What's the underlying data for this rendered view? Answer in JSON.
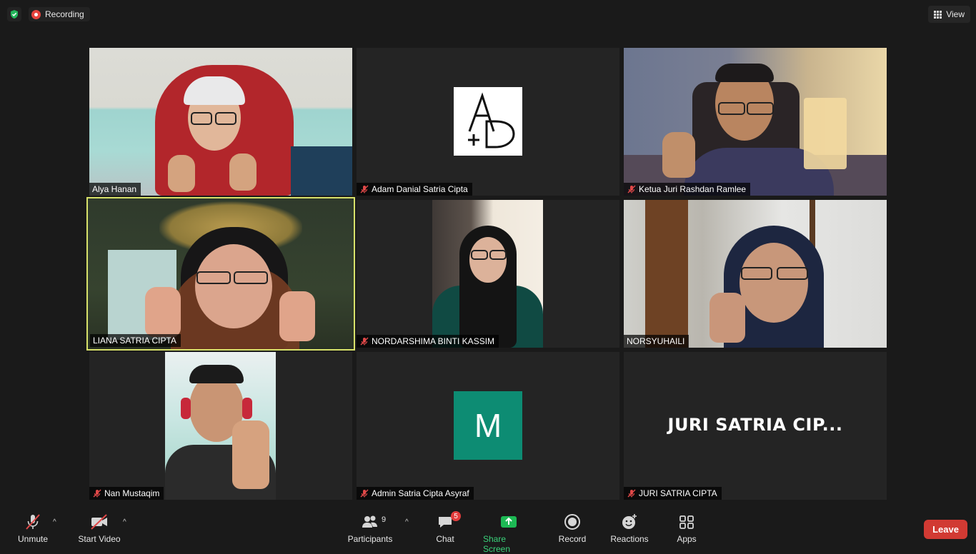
{
  "topbar": {
    "recording_label": "Recording",
    "view_label": "View"
  },
  "participants": [
    {
      "name": "Alya Hanan",
      "muted": false
    },
    {
      "name": "Adam Danial Satria Cipta",
      "muted": true
    },
    {
      "name": "Ketua Juri Rashdan Ramlee",
      "muted": true
    },
    {
      "name": "LIANA SATRIA CIPTA",
      "muted": false,
      "active_speaker": true
    },
    {
      "name": "NORDARSHIMA BINTI KASSIM",
      "muted": true
    },
    {
      "name": "NORSYUHAILI",
      "muted": false
    },
    {
      "name": "Nan Mustaqim",
      "muted": true
    },
    {
      "name": "Admin Satria Cipta Asyraf",
      "muted": true
    },
    {
      "name": "JURI SATRIA CIPTA",
      "muted": true
    }
  ],
  "tiles": {
    "adam_avatar_text": "A+D",
    "admin_avatar_letter": "M",
    "juri_display_name": "JURI SATRIA CIP..."
  },
  "toolbar": {
    "unmute": "Unmute",
    "start_video": "Start Video",
    "participants": "Participants",
    "participants_count": "9",
    "chat": "Chat",
    "chat_badge": "5",
    "share_screen": "Share Screen",
    "record": "Record",
    "reactions": "Reactions",
    "apps": "Apps",
    "leave": "Leave"
  },
  "colors": {
    "active_speaker_border": "#d8e26a",
    "share_green": "#3ad27a",
    "leave_red": "#d13a33",
    "muted_red": "#e04848",
    "avatar_teal": "#0d8c73"
  }
}
